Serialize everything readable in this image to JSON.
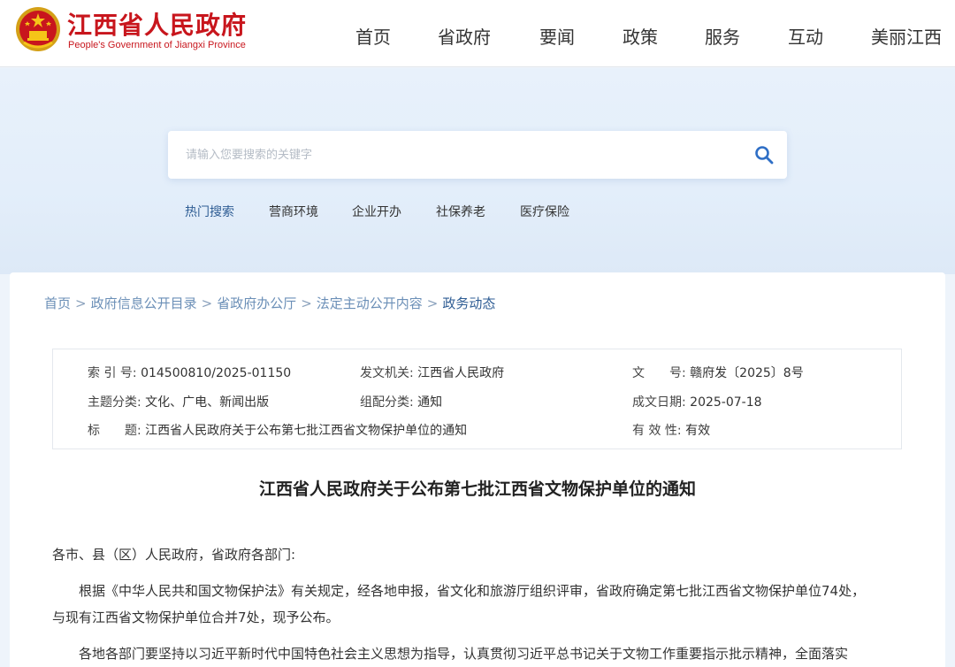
{
  "header": {
    "title": "江西省人民政府",
    "subtitle": "People's Government of Jiangxi Province",
    "nav": [
      "首页",
      "省政府",
      "要闻",
      "政策",
      "服务",
      "互动",
      "美丽江西"
    ]
  },
  "search": {
    "placeholder": "请输入您要搜索的关键字",
    "hot": [
      "热门搜索",
      "营商环境",
      "企业开办",
      "社保养老",
      "医疗保险"
    ]
  },
  "breadcrumb": [
    "首页",
    "政府信息公开目录",
    "省政府办公厅",
    "法定主动公开内容",
    "政务动态"
  ],
  "meta": {
    "index_label": "索 引 号:",
    "index_value": "014500810/2025-01150",
    "issuer_label": "发文机关:",
    "issuer_value": "江西省人民政府",
    "docno_label": "文　　号:",
    "docno_value": "赣府发〔2025〕8号",
    "category_label": "主题分类:",
    "category_value": "文化、广电、新闻出版",
    "genre_label": "组配分类:",
    "genre_value": "通知",
    "date_label": "成文日期:",
    "date_value": "2025-07-18",
    "subject_label": "标　　题:",
    "subject_value": "江西省人民政府关于公布第七批江西省文物保护单位的通知",
    "validity_label": "有 效 性:",
    "validity_value": "有效"
  },
  "article": {
    "title": "江西省人民政府关于公布第七批江西省文物保护单位的通知",
    "salutation": "各市、县（区）人民政府，省政府各部门:",
    "p1_line1": "根据《中华人民共和国文物保护法》有关规定，经各地申报，省文化和旅游厅组织评审，省政府确定第七批江西省文物保护单位74处，",
    "p1_line2": "与现有江西省文物保护单位合并7处，现予公布。",
    "p2_line1": "各地各部门要坚持以习近平新时代中国特色社会主义思想为指导，认真贯彻习近平总书记关于文物工作重要指示批示精神，全面落实"
  },
  "colors": {
    "brand_red": "#c8161d",
    "link_blue": "#2f5d94",
    "search_icon": "#2f6fc6"
  }
}
